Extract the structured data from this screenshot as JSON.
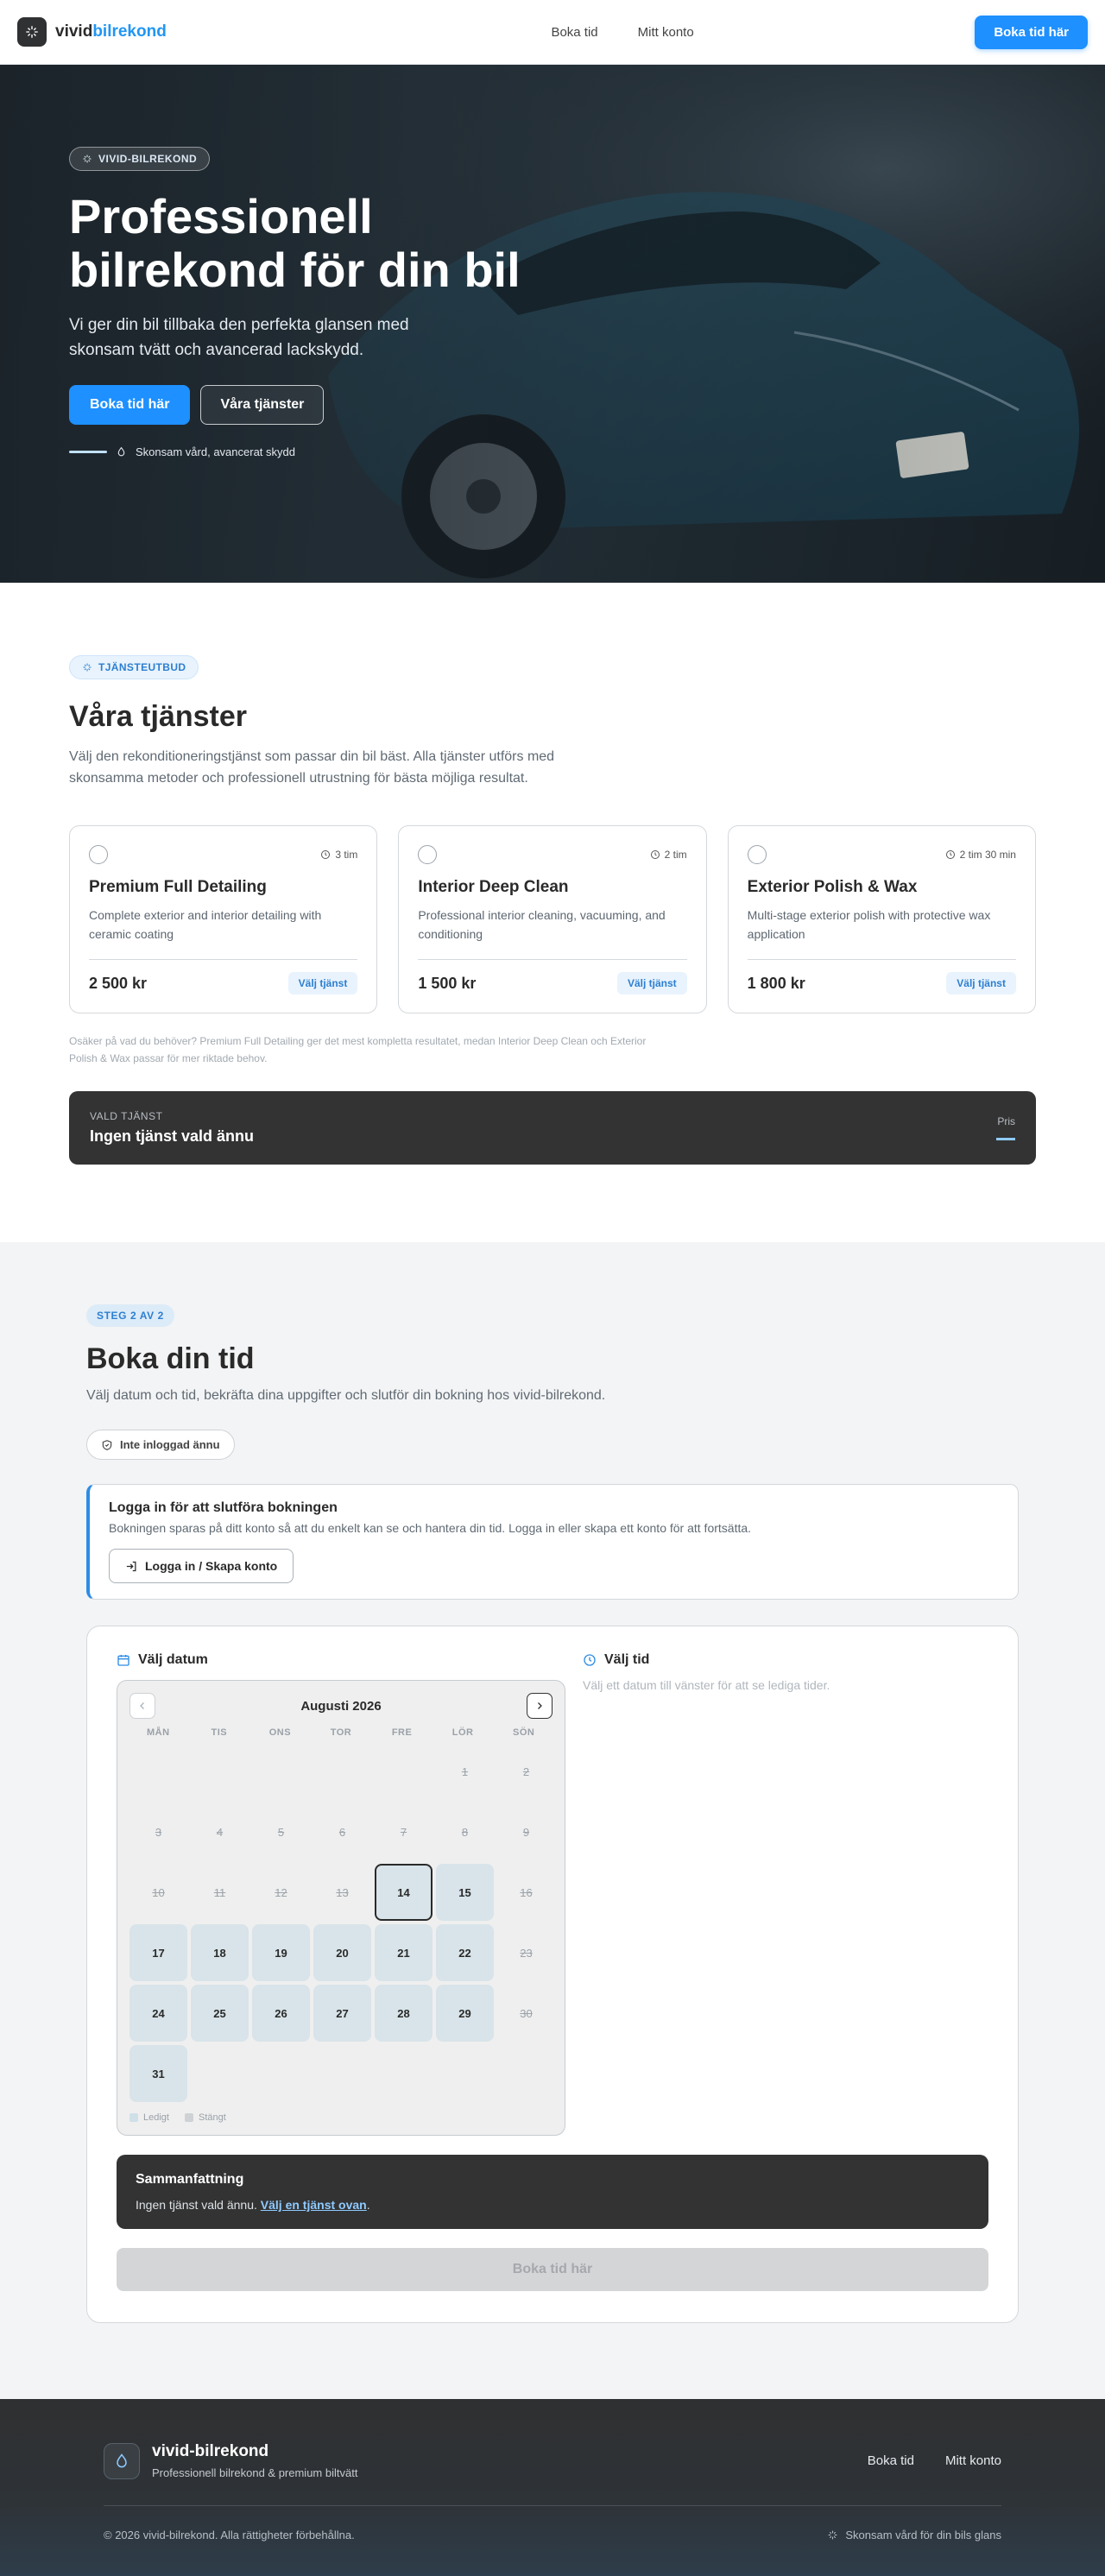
{
  "header": {
    "brand_prefix": "vivid",
    "brand_suffix": "bilrekond",
    "nav": [
      "Boka tid",
      "Mitt konto"
    ],
    "cta": "Boka tid här"
  },
  "hero": {
    "badge": "VIVID-BILREKOND",
    "title": "Professionell bilrekond för din bil",
    "subtitle": "Vi ger din bil tillbaka den perfekta glansen med skonsam tvätt och avancerad lackskydd.",
    "primary_button": "Boka tid här",
    "secondary_button": "Våra tjänster",
    "tagline": "Skonsam vård, avancerat skydd"
  },
  "services": {
    "badge": "TJÄNSTEUTBUD",
    "title": "Våra tjänster",
    "subtitle": "Välj den rekonditioneringstjänst som passar din bil bäst. Alla tjänster utförs med skonsamma metoder och professionell utrustning för bästa möjliga resultat.",
    "items": [
      {
        "name": "Premium Full Detailing",
        "duration": "3 tim",
        "description": "Complete exterior and interior detailing with ceramic coating",
        "price": "2 500 kr",
        "select": "Välj tjänst"
      },
      {
        "name": "Interior Deep Clean",
        "duration": "2 tim",
        "description": "Professional interior cleaning, vacuuming, and conditioning",
        "price": "1 500 kr",
        "select": "Välj tjänst"
      },
      {
        "name": "Exterior Polish & Wax",
        "duration": "2 tim 30 min",
        "description": "Multi-stage exterior polish with protective wax application",
        "price": "1 800 kr",
        "select": "Välj tjänst"
      }
    ],
    "hint": "Osäker på vad du behöver? Premium Full Detailing ger det mest kompletta resultatet, medan Interior Deep Clean och Exterior Polish & Wax passar för mer riktade behov.",
    "chosen_label": "VALD TJÄNST",
    "chosen_value": "Ingen tjänst vald ännu",
    "price_label": "Pris"
  },
  "booking": {
    "step": "STEG 2 AV 2",
    "title": "Boka din tid",
    "subtitle": "Välj datum och tid, bekräfta dina uppgifter och slutför din bokning hos vivid-bilrekond.",
    "login_status": "Inte inloggad ännu",
    "login_title": "Logga in för att slutföra bokningen",
    "login_text": "Bokningen sparas på ditt konto så att du enkelt kan se och hantera din tid. Logga in eller skapa ett konto för att fortsätta.",
    "login_button": "Logga in / Skapa konto",
    "date_heading": "Välj datum",
    "time_heading": "Välj tid",
    "time_hint": "Välj ett datum till vänster för att se lediga tider.",
    "calendar": {
      "month": "Augusti 2026",
      "weekdays": [
        "MÅN",
        "TIS",
        "ONS",
        "TOR",
        "FRE",
        "LÖR",
        "SÖN"
      ],
      "leading_blanks": 5,
      "days": [
        {
          "d": "1",
          "s": "closed"
        },
        {
          "d": "2",
          "s": "closed"
        },
        {
          "d": "3",
          "s": "closed"
        },
        {
          "d": "4",
          "s": "closed"
        },
        {
          "d": "5",
          "s": "closed"
        },
        {
          "d": "6",
          "s": "closed"
        },
        {
          "d": "7",
          "s": "closed"
        },
        {
          "d": "8",
          "s": "closed"
        },
        {
          "d": "9",
          "s": "closed"
        },
        {
          "d": "10",
          "s": "closed"
        },
        {
          "d": "11",
          "s": "closed"
        },
        {
          "d": "12",
          "s": "closed"
        },
        {
          "d": "13",
          "s": "closed"
        },
        {
          "d": "14",
          "s": "selected"
        },
        {
          "d": "15",
          "s": "free"
        },
        {
          "d": "16",
          "s": "closed"
        },
        {
          "d": "17",
          "s": "free"
        },
        {
          "d": "18",
          "s": "free"
        },
        {
          "d": "19",
          "s": "free"
        },
        {
          "d": "20",
          "s": "free"
        },
        {
          "d": "21",
          "s": "free"
        },
        {
          "d": "22",
          "s": "free"
        },
        {
          "d": "23",
          "s": "closed"
        },
        {
          "d": "24",
          "s": "free"
        },
        {
          "d": "25",
          "s": "free"
        },
        {
          "d": "26",
          "s": "free"
        },
        {
          "d": "27",
          "s": "free"
        },
        {
          "d": "28",
          "s": "free"
        },
        {
          "d": "29",
          "s": "free"
        },
        {
          "d": "30",
          "s": "closed"
        },
        {
          "d": "31",
          "s": "free"
        }
      ],
      "legend_free": "Ledigt",
      "legend_closed": "Stängt"
    },
    "summary_title": "Sammanfattning",
    "summary_text": "Ingen tjänst vald ännu. ",
    "summary_link": "Välj en tjänst ovan",
    "summary_end": ".",
    "submit": "Boka tid här"
  },
  "footer": {
    "name": "vivid-bilrekond",
    "tagline": "Professionell bilrekond & premium biltvätt",
    "nav": [
      "Boka tid",
      "Mitt konto"
    ],
    "copyright": "© 2026 vivid-bilrekond. Alla rättigheter förbehållna.",
    "slogan": "Skonsam vård för din bils glans"
  },
  "colors": {
    "accent": "#1e90ff",
    "dark": "#333333",
    "free_day": "#d8e4e9"
  }
}
